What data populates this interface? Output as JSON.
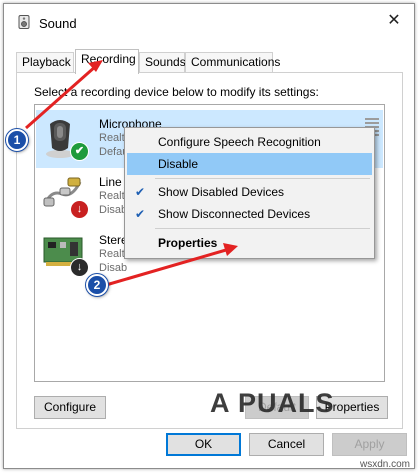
{
  "window": {
    "title": "Sound",
    "close_glyph": "✕"
  },
  "tabs": [
    {
      "label": "Playback"
    },
    {
      "label": "Recording",
      "active": true
    },
    {
      "label": "Sounds"
    },
    {
      "label": "Communications"
    }
  ],
  "instruction": "Select a recording device below to modify its settings:",
  "devices": [
    {
      "name": "Microphone",
      "line1": "Realt",
      "line2": "Defau",
      "status": "default",
      "badge_color": "#1e9b3c"
    },
    {
      "name": "Line I",
      "line1": "Realt",
      "line2": "Disab",
      "status": "disabled",
      "badge_color": "#c82020"
    },
    {
      "name": "Stere",
      "line1": "Realt",
      "line2": "Disab",
      "status": "disabled",
      "badge_color": "#2b2b2b"
    }
  ],
  "context_menu": {
    "items": [
      {
        "label": "Configure Speech Recognition",
        "checked": false
      },
      {
        "label": "Disable",
        "checked": false,
        "highlighted": true
      },
      {
        "label": "Show Disabled Devices",
        "checked": true
      },
      {
        "label": "Show Disconnected Devices",
        "checked": true
      },
      {
        "label": "Properties",
        "bold": true
      }
    ],
    "check_glyph": "✔"
  },
  "panel_buttons": {
    "configure": "Configure",
    "set_default": "Default",
    "properties": "Properties"
  },
  "footer_buttons": {
    "ok": "OK",
    "cancel": "Cancel",
    "apply": "Apply"
  },
  "annotations": {
    "step1": "1",
    "step2": "2",
    "arrow_color": "#e32222",
    "marker_color": "#1b4fa8"
  },
  "watermark": {
    "logo": "A PUALS",
    "site": "wsxdn.com"
  }
}
